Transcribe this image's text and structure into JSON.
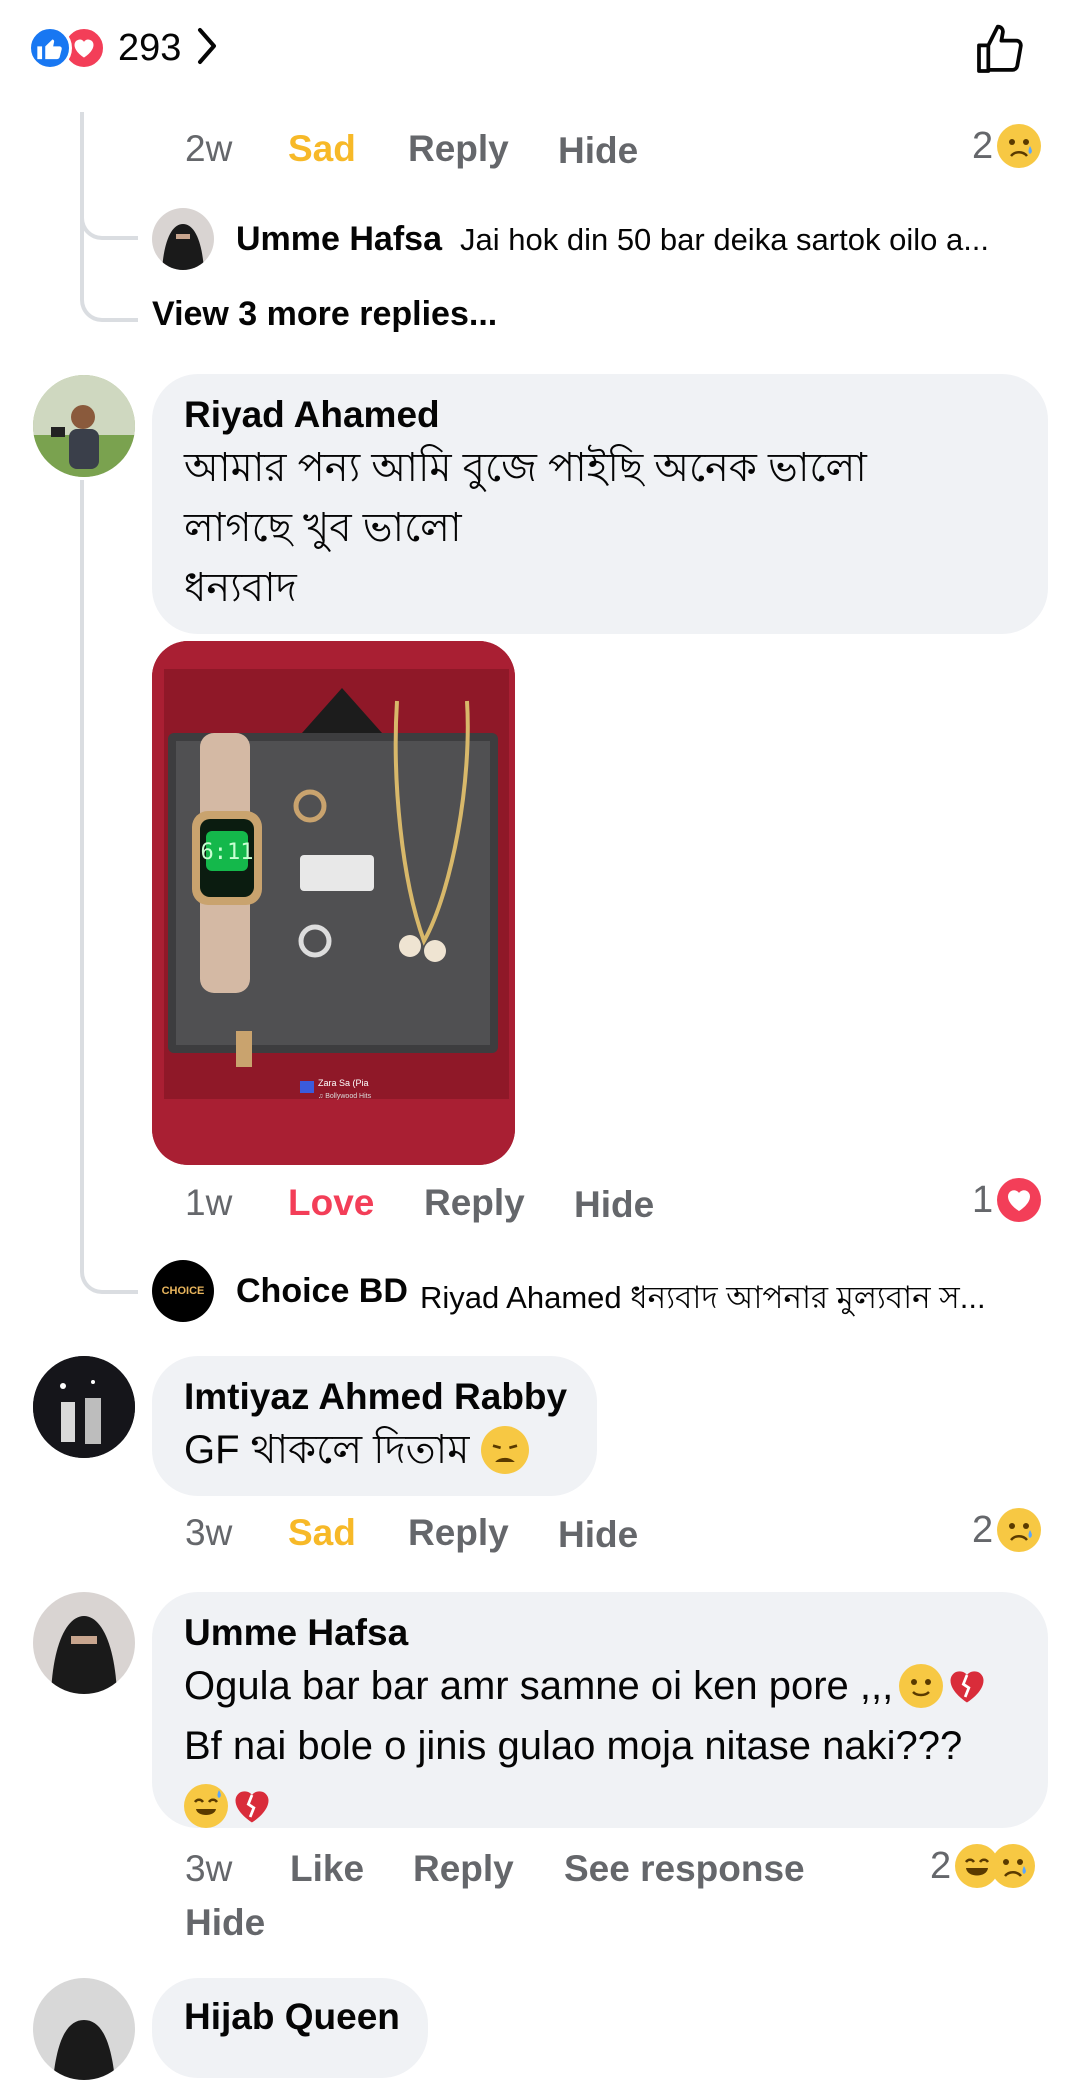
{
  "top_bar": {
    "reaction_count": "293",
    "chevron": "›"
  },
  "c1": {
    "time": "2w",
    "reaction": "Sad",
    "reply": "Reply",
    "hide": "Hide",
    "count": "2"
  },
  "reply1": {
    "name": "Umme Hafsa",
    "text": "Jai hok din 50 bar deika sartok oilo a..."
  },
  "view_more": "View 3 more replies...",
  "c2": {
    "name": "Riyad Ahamed",
    "lines": [
      "আমার পন্য আমি বুজে পাইছি অনেক ভালো",
      "লাগছে খুব ভালো",
      "ধন্যবাদ"
    ],
    "image": {
      "watch_time": "6:11",
      "caption": "Zara Sa (Pia",
      "caption2": "♫ Bollywood Hits"
    },
    "time": "1w",
    "reaction": "Love",
    "reply": "Reply",
    "hide": "Hide",
    "count": "1"
  },
  "reply2": {
    "avatar_text": "CHOICE",
    "name": "Choice BD",
    "text": "Riyad Ahamed ধন্যবাদ আপনার মুল্যবান স..."
  },
  "c3": {
    "name": "Imtiyaz Ahmed Rabby",
    "text": "GF থাকলে দিতাম",
    "time": "3w",
    "reaction": "Sad",
    "reply": "Reply",
    "hide": "Hide",
    "count": "2"
  },
  "c4": {
    "name": "Umme Hafsa",
    "line1": "Ogula bar bar amr samne oi ken pore ,,,",
    "line2": "Bf nai bole o jinis gulao moja nitase naki???",
    "time": "3w",
    "like": "Like",
    "reply": "Reply",
    "see_response": "See response",
    "count": "2",
    "hide": "Hide"
  },
  "c5": {
    "name": "Hijab Queen"
  },
  "colors": {
    "sad": "#f7b928",
    "love": "#f33e58",
    "like_blue": "#1877f2",
    "bubble": "#f0f2f5",
    "meta": "#65676b"
  }
}
